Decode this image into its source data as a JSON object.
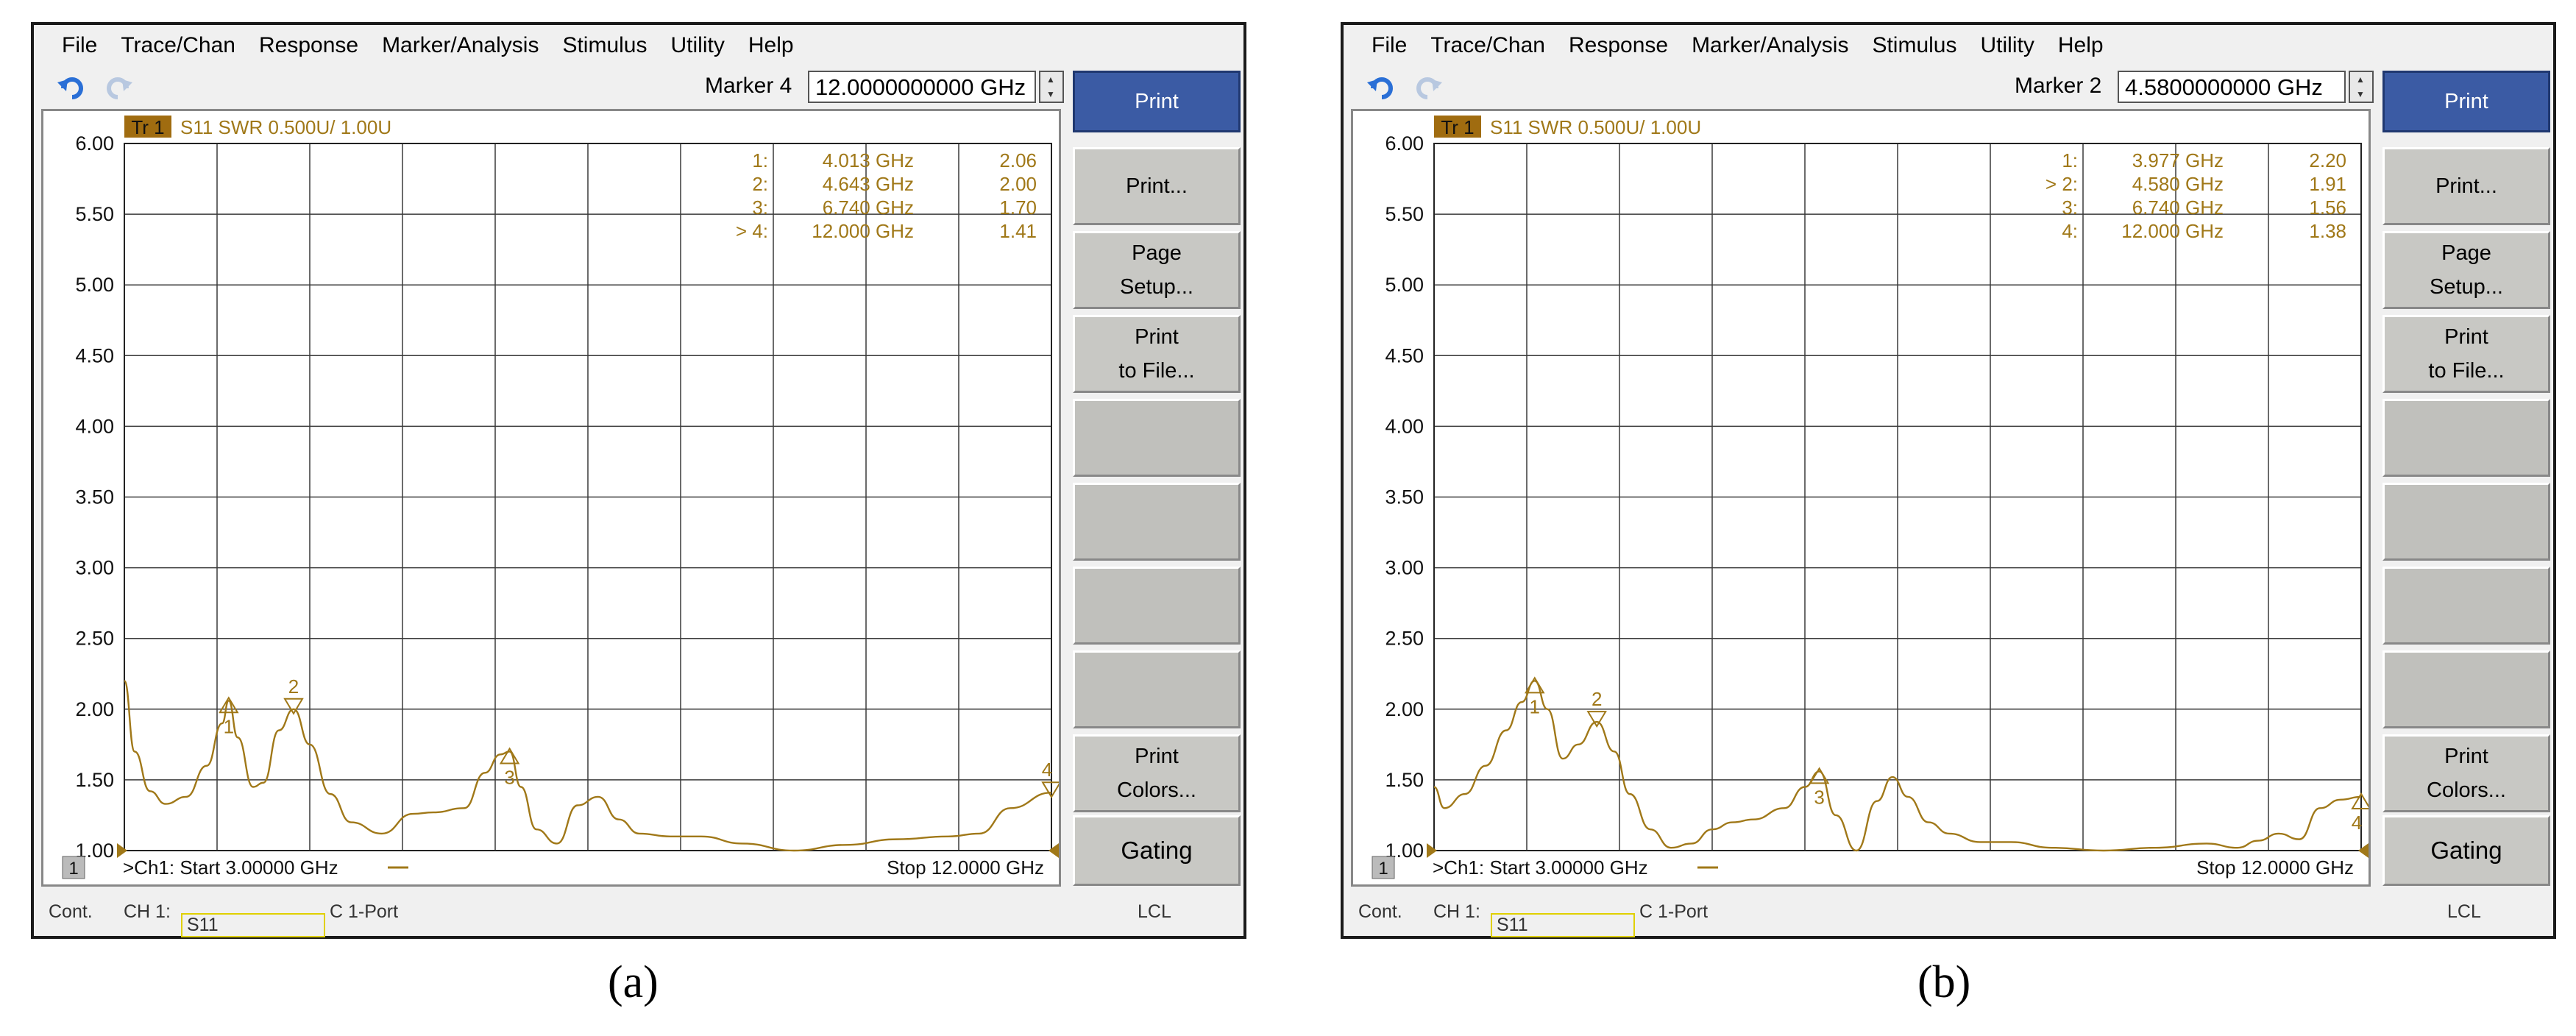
{
  "menu": [
    "File",
    "Trace/Chan",
    "Response",
    "Marker/Analysis",
    "Stimulus",
    "Utility",
    "Help"
  ],
  "sidebar": {
    "buttons": [
      "Print",
      "Print...",
      "Page|Setup...",
      "Print|to File...",
      "",
      "",
      "",
      "",
      "Print|Colors...",
      "Gating"
    ]
  },
  "colors": {
    "trace": "#a07818",
    "title_box": "#a06c10",
    "primary_button": "#3b5ba4",
    "grid": "#333333"
  },
  "panels": [
    {
      "caption": "(a)",
      "marker_label": "Marker 4",
      "marker_value": "12.0000000000 GHz",
      "trace_badge": "Tr 1",
      "trace_title": "S11 SWR 0.500U/  1.00U",
      "channel_badge": "1",
      "start_text": ">Ch1:  Start  3.00000 GHz",
      "stop_text": "Stop  12.0000 GHz",
      "status": {
        "cont": "Cont.",
        "ch": "CH 1:",
        "param": "S11",
        "cal": "C  1-Port",
        "lcl": "LCL"
      },
      "marker_table": [
        {
          "id": "1:",
          "freq": "4.013 GHz",
          "val": "2.06"
        },
        {
          "id": "2:",
          "freq": "4.643 GHz",
          "val": "2.00"
        },
        {
          "id": "3:",
          "freq": "6.740 GHz",
          "val": "1.70"
        },
        {
          "id": "> 4:",
          "freq": "12.000 GHz",
          "val": "1.41"
        }
      ],
      "chart_data": {
        "type": "line",
        "x_unit": "GHz",
        "ylim": [
          1.0,
          6.0
        ],
        "xlim": [
          3.0,
          12.0
        ],
        "yticks": [
          "6.00",
          "5.50",
          "5.00",
          "4.50",
          "4.00",
          "3.50",
          "3.00",
          "2.50",
          "2.00",
          "1.50",
          "1.00"
        ],
        "series": [
          {
            "x": [
              3.0,
              3.1,
              3.25,
              3.4,
              3.6,
              3.8,
              3.95,
              4.013,
              4.1,
              4.25,
              4.35,
              4.5,
              4.643,
              4.8,
              5.0,
              5.2,
              5.5,
              5.8,
              6.0,
              6.3,
              6.5,
              6.65,
              6.74,
              6.85,
              7.0,
              7.2,
              7.4,
              7.6,
              7.8,
              8.0,
              8.3,
              8.6,
              9.0,
              9.5,
              10.0,
              10.5,
              11.0,
              11.3,
              11.6,
              12.0
            ],
            "y": [
              2.2,
              1.7,
              1.42,
              1.33,
              1.38,
              1.6,
              1.9,
              2.06,
              1.8,
              1.45,
              1.48,
              1.85,
              2.0,
              1.75,
              1.4,
              1.2,
              1.12,
              1.26,
              1.27,
              1.3,
              1.55,
              1.68,
              1.7,
              1.45,
              1.15,
              1.05,
              1.32,
              1.38,
              1.22,
              1.12,
              1.1,
              1.1,
              1.05,
              1.0,
              1.04,
              1.08,
              1.1,
              1.12,
              1.3,
              1.41
            ]
          }
        ],
        "markers": [
          {
            "label": "1",
            "x": 4.013,
            "y": 2.06
          },
          {
            "label": "2",
            "x": 4.643,
            "y": 2.0
          },
          {
            "label": "3",
            "x": 6.74,
            "y": 1.7
          },
          {
            "label": "4",
            "x": 12.0,
            "y": 1.41
          }
        ]
      }
    },
    {
      "caption": "(b)",
      "marker_label": "Marker 2",
      "marker_value": "4.5800000000 GHz",
      "trace_badge": "Tr 1",
      "trace_title": "S11 SWR 0.500U/  1.00U",
      "channel_badge": "1",
      "start_text": ">Ch1:  Start  3.00000 GHz",
      "stop_text": "Stop  12.0000 GHz",
      "status": {
        "cont": "Cont.",
        "ch": "CH 1:",
        "param": "S11",
        "cal": "C  1-Port",
        "lcl": "LCL"
      },
      "marker_table": [
        {
          "id": "1:",
          "freq": "3.977 GHz",
          "val": "2.20"
        },
        {
          "id": "> 2:",
          "freq": "4.580 GHz",
          "val": "1.91"
        },
        {
          "id": "3:",
          "freq": "6.740 GHz",
          "val": "1.56"
        },
        {
          "id": "4:",
          "freq": "12.000 GHz",
          "val": "1.38"
        }
      ],
      "chart_data": {
        "type": "line",
        "x_unit": "GHz",
        "ylim": [
          1.0,
          6.0
        ],
        "xlim": [
          3.0,
          12.0
        ],
        "yticks": [
          "6.00",
          "5.50",
          "5.00",
          "4.50",
          "4.00",
          "3.50",
          "3.00",
          "2.50",
          "2.00",
          "1.50",
          "1.00"
        ],
        "series": [
          {
            "x": [
              3.0,
              3.1,
              3.3,
              3.5,
              3.7,
              3.85,
              3.977,
              4.1,
              4.25,
              4.4,
              4.58,
              4.75,
              4.9,
              5.1,
              5.3,
              5.5,
              5.7,
              5.9,
              6.1,
              6.4,
              6.6,
              6.74,
              6.9,
              7.1,
              7.3,
              7.45,
              7.6,
              7.8,
              8.0,
              8.3,
              8.6,
              9.0,
              9.5,
              10.0,
              10.5,
              10.8,
              11.0,
              11.2,
              11.4,
              11.6,
              11.8,
              12.0
            ],
            "y": [
              1.45,
              1.3,
              1.4,
              1.6,
              1.85,
              2.05,
              2.2,
              2.0,
              1.65,
              1.75,
              1.91,
              1.7,
              1.4,
              1.15,
              1.02,
              1.05,
              1.15,
              1.2,
              1.22,
              1.3,
              1.45,
              1.56,
              1.25,
              1.0,
              1.35,
              1.52,
              1.38,
              1.2,
              1.12,
              1.06,
              1.06,
              1.02,
              1.0,
              1.02,
              1.05,
              1.02,
              1.07,
              1.12,
              1.08,
              1.3,
              1.36,
              1.38
            ]
          }
        ],
        "markers": [
          {
            "label": "1",
            "x": 3.977,
            "y": 2.2
          },
          {
            "label": "2",
            "x": 4.58,
            "y": 1.91
          },
          {
            "label": "3",
            "x": 6.74,
            "y": 1.56
          },
          {
            "label": "4",
            "x": 12.0,
            "y": 1.38
          }
        ]
      }
    }
  ]
}
